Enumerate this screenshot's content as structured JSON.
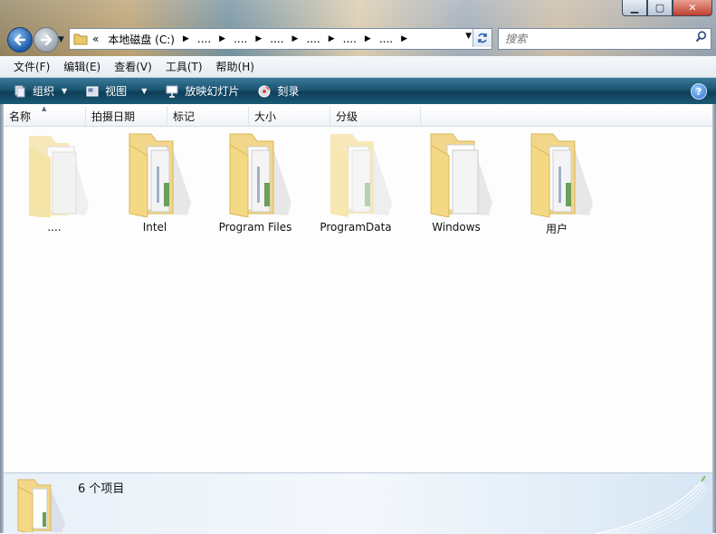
{
  "window": {
    "minimize": "▁",
    "maximize": "▢",
    "close": "✕"
  },
  "nav": {
    "back_icon": "arrow-left-icon",
    "forward_icon": "arrow-right-icon"
  },
  "address": {
    "prefix": "«",
    "crumbs": [
      "本地磁盘 (C:)",
      "....",
      "....",
      "....",
      "....",
      "....",
      "...."
    ]
  },
  "search": {
    "placeholder": "搜索"
  },
  "menu": {
    "items": [
      "文件(F)",
      "编辑(E)",
      "查看(V)",
      "工具(T)",
      "帮助(H)"
    ]
  },
  "commands": {
    "organize": "组织",
    "views": "视图",
    "slideshow": "放映幻灯片",
    "burn": "刻录",
    "help": "?"
  },
  "columns": [
    "名称",
    "拍摄日期",
    "标记",
    "大小",
    "分级"
  ],
  "items": [
    {
      "label": "....",
      "style": "faded"
    },
    {
      "label": "Intel",
      "style": "normal"
    },
    {
      "label": "Program Files",
      "style": "normal"
    },
    {
      "label": "ProgramData",
      "style": "faded"
    },
    {
      "label": "Windows",
      "style": "docs"
    },
    {
      "label": "用户",
      "style": "normal"
    }
  ],
  "details": {
    "count": "6 个项目"
  },
  "colors": {
    "folder": "#f2d78a",
    "folder_dark": "#d9b65a",
    "cmdbar": "#1a5470"
  }
}
